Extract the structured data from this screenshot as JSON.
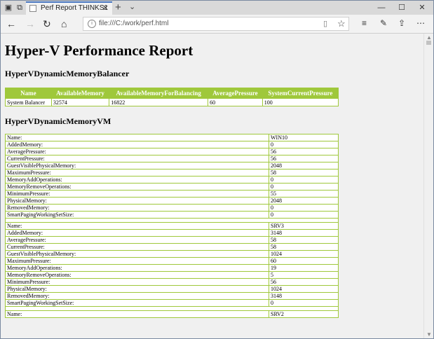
{
  "browser": {
    "tab_title": "Perf Report THINKS1",
    "tab_close": "✕",
    "new_tab": "+",
    "tab_list": "⌄",
    "address_url": "file:///C:/work/perf.html",
    "window_buttons": [
      "—",
      "☐",
      "✕"
    ]
  },
  "report": {
    "title": "Hyper-V Performance Report",
    "balancer_section": "HyperVDynamicMemoryBalancer",
    "balancer_headers": [
      "Name",
      "AvailableMemory",
      "AvailableMemoryForBalancing",
      "AveragePressure",
      "SystemCurrentPressure"
    ],
    "balancer_rows": [
      [
        "System Balancer",
        "32574",
        "16822",
        "60",
        "100"
      ]
    ],
    "vm_section": "HyperVDynamicMemoryVM",
    "vm_blocks": [
      [
        [
          "Name:",
          "WIN10"
        ],
        [
          "AddedMemory:",
          "0"
        ],
        [
          "AveragePressure:",
          "56"
        ],
        [
          "CurrentPressure:",
          "56"
        ],
        [
          "GuestVisiblePhysicalMemory:",
          "2048"
        ],
        [
          "MaximumPressure:",
          "58"
        ],
        [
          "MemoryAddOperations:",
          "0"
        ],
        [
          "MemoryRemoveOperations:",
          "0"
        ],
        [
          "MinimumPressure:",
          "55"
        ],
        [
          "PhysicalMemory:",
          "2048"
        ],
        [
          "RemovedMemory:",
          "0"
        ],
        [
          "SmartPagingWorkingSetSize:",
          "0"
        ]
      ],
      [
        [
          "Name:",
          "SRV3"
        ],
        [
          "AddedMemory:",
          "3148"
        ],
        [
          "AveragePressure:",
          "58"
        ],
        [
          "CurrentPressure:",
          "58"
        ],
        [
          "GuestVisiblePhysicalMemory:",
          "1024"
        ],
        [
          "MaximumPressure:",
          "60"
        ],
        [
          "MemoryAddOperations:",
          "19"
        ],
        [
          "MemoryRemoveOperations:",
          "5"
        ],
        [
          "MinimumPressure:",
          "56"
        ],
        [
          "PhysicalMemory:",
          "1024"
        ],
        [
          "RemovedMemory:",
          "3148"
        ],
        [
          "SmartPagingWorkingSetSize:",
          "0"
        ]
      ],
      [
        [
          "Name:",
          "SRV2"
        ]
      ]
    ]
  }
}
